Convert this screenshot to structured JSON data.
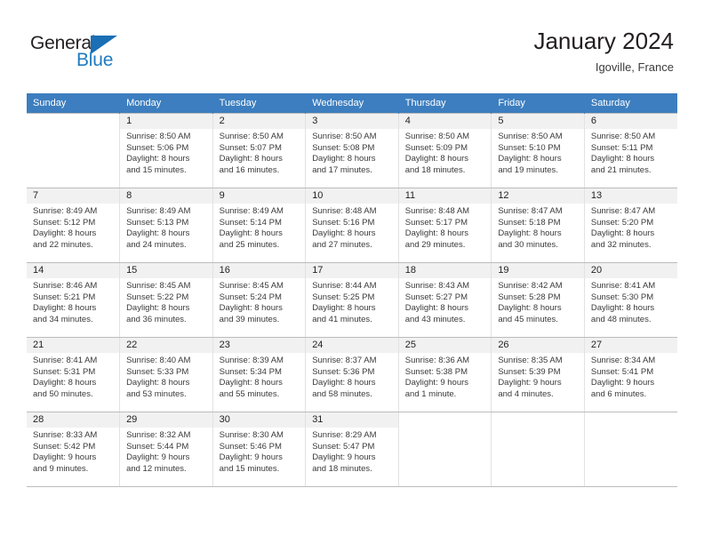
{
  "brand": {
    "word_one": "General",
    "word_two": "Blue",
    "flag_icon": "blue-triangle-flag-icon",
    "accent_color": "#1f7bc1"
  },
  "header": {
    "title": "January 2024",
    "subtitle": "Igoville, France"
  },
  "theme": {
    "header_row_bg": "#3c7ebf",
    "daynum_band_bg": "#f1f1f1",
    "grid_line": "#bcbcbc",
    "text": "#231f20"
  },
  "weekday_headers": [
    "Sunday",
    "Monday",
    "Tuesday",
    "Wednesday",
    "Thursday",
    "Friday",
    "Saturday"
  ],
  "weeks": [
    [
      {
        "day": "",
        "lines": []
      },
      {
        "day": "1",
        "lines": [
          "Sunrise: 8:50 AM",
          "Sunset: 5:06 PM",
          "Daylight: 8 hours",
          "and 15 minutes."
        ]
      },
      {
        "day": "2",
        "lines": [
          "Sunrise: 8:50 AM",
          "Sunset: 5:07 PM",
          "Daylight: 8 hours",
          "and 16 minutes."
        ]
      },
      {
        "day": "3",
        "lines": [
          "Sunrise: 8:50 AM",
          "Sunset: 5:08 PM",
          "Daylight: 8 hours",
          "and 17 minutes."
        ]
      },
      {
        "day": "4",
        "lines": [
          "Sunrise: 8:50 AM",
          "Sunset: 5:09 PM",
          "Daylight: 8 hours",
          "and 18 minutes."
        ]
      },
      {
        "day": "5",
        "lines": [
          "Sunrise: 8:50 AM",
          "Sunset: 5:10 PM",
          "Daylight: 8 hours",
          "and 19 minutes."
        ]
      },
      {
        "day": "6",
        "lines": [
          "Sunrise: 8:50 AM",
          "Sunset: 5:11 PM",
          "Daylight: 8 hours",
          "and 21 minutes."
        ]
      }
    ],
    [
      {
        "day": "7",
        "lines": [
          "Sunrise: 8:49 AM",
          "Sunset: 5:12 PM",
          "Daylight: 8 hours",
          "and 22 minutes."
        ]
      },
      {
        "day": "8",
        "lines": [
          "Sunrise: 8:49 AM",
          "Sunset: 5:13 PM",
          "Daylight: 8 hours",
          "and 24 minutes."
        ]
      },
      {
        "day": "9",
        "lines": [
          "Sunrise: 8:49 AM",
          "Sunset: 5:14 PM",
          "Daylight: 8 hours",
          "and 25 minutes."
        ]
      },
      {
        "day": "10",
        "lines": [
          "Sunrise: 8:48 AM",
          "Sunset: 5:16 PM",
          "Daylight: 8 hours",
          "and 27 minutes."
        ]
      },
      {
        "day": "11",
        "lines": [
          "Sunrise: 8:48 AM",
          "Sunset: 5:17 PM",
          "Daylight: 8 hours",
          "and 29 minutes."
        ]
      },
      {
        "day": "12",
        "lines": [
          "Sunrise: 8:47 AM",
          "Sunset: 5:18 PM",
          "Daylight: 8 hours",
          "and 30 minutes."
        ]
      },
      {
        "day": "13",
        "lines": [
          "Sunrise: 8:47 AM",
          "Sunset: 5:20 PM",
          "Daylight: 8 hours",
          "and 32 minutes."
        ]
      }
    ],
    [
      {
        "day": "14",
        "lines": [
          "Sunrise: 8:46 AM",
          "Sunset: 5:21 PM",
          "Daylight: 8 hours",
          "and 34 minutes."
        ]
      },
      {
        "day": "15",
        "lines": [
          "Sunrise: 8:45 AM",
          "Sunset: 5:22 PM",
          "Daylight: 8 hours",
          "and 36 minutes."
        ]
      },
      {
        "day": "16",
        "lines": [
          "Sunrise: 8:45 AM",
          "Sunset: 5:24 PM",
          "Daylight: 8 hours",
          "and 39 minutes."
        ]
      },
      {
        "day": "17",
        "lines": [
          "Sunrise: 8:44 AM",
          "Sunset: 5:25 PM",
          "Daylight: 8 hours",
          "and 41 minutes."
        ]
      },
      {
        "day": "18",
        "lines": [
          "Sunrise: 8:43 AM",
          "Sunset: 5:27 PM",
          "Daylight: 8 hours",
          "and 43 minutes."
        ]
      },
      {
        "day": "19",
        "lines": [
          "Sunrise: 8:42 AM",
          "Sunset: 5:28 PM",
          "Daylight: 8 hours",
          "and 45 minutes."
        ]
      },
      {
        "day": "20",
        "lines": [
          "Sunrise: 8:41 AM",
          "Sunset: 5:30 PM",
          "Daylight: 8 hours",
          "and 48 minutes."
        ]
      }
    ],
    [
      {
        "day": "21",
        "lines": [
          "Sunrise: 8:41 AM",
          "Sunset: 5:31 PM",
          "Daylight: 8 hours",
          "and 50 minutes."
        ]
      },
      {
        "day": "22",
        "lines": [
          "Sunrise: 8:40 AM",
          "Sunset: 5:33 PM",
          "Daylight: 8 hours",
          "and 53 minutes."
        ]
      },
      {
        "day": "23",
        "lines": [
          "Sunrise: 8:39 AM",
          "Sunset: 5:34 PM",
          "Daylight: 8 hours",
          "and 55 minutes."
        ]
      },
      {
        "day": "24",
        "lines": [
          "Sunrise: 8:37 AM",
          "Sunset: 5:36 PM",
          "Daylight: 8 hours",
          "and 58 minutes."
        ]
      },
      {
        "day": "25",
        "lines": [
          "Sunrise: 8:36 AM",
          "Sunset: 5:38 PM",
          "Daylight: 9 hours",
          "and 1 minute."
        ]
      },
      {
        "day": "26",
        "lines": [
          "Sunrise: 8:35 AM",
          "Sunset: 5:39 PM",
          "Daylight: 9 hours",
          "and 4 minutes."
        ]
      },
      {
        "day": "27",
        "lines": [
          "Sunrise: 8:34 AM",
          "Sunset: 5:41 PM",
          "Daylight: 9 hours",
          "and 6 minutes."
        ]
      }
    ],
    [
      {
        "day": "28",
        "lines": [
          "Sunrise: 8:33 AM",
          "Sunset: 5:42 PM",
          "Daylight: 9 hours",
          "and 9 minutes."
        ]
      },
      {
        "day": "29",
        "lines": [
          "Sunrise: 8:32 AM",
          "Sunset: 5:44 PM",
          "Daylight: 9 hours",
          "and 12 minutes."
        ]
      },
      {
        "day": "30",
        "lines": [
          "Sunrise: 8:30 AM",
          "Sunset: 5:46 PM",
          "Daylight: 9 hours",
          "and 15 minutes."
        ]
      },
      {
        "day": "31",
        "lines": [
          "Sunrise: 8:29 AM",
          "Sunset: 5:47 PM",
          "Daylight: 9 hours",
          "and 18 minutes."
        ]
      },
      {
        "day": "",
        "lines": []
      },
      {
        "day": "",
        "lines": []
      },
      {
        "day": "",
        "lines": []
      }
    ]
  ]
}
